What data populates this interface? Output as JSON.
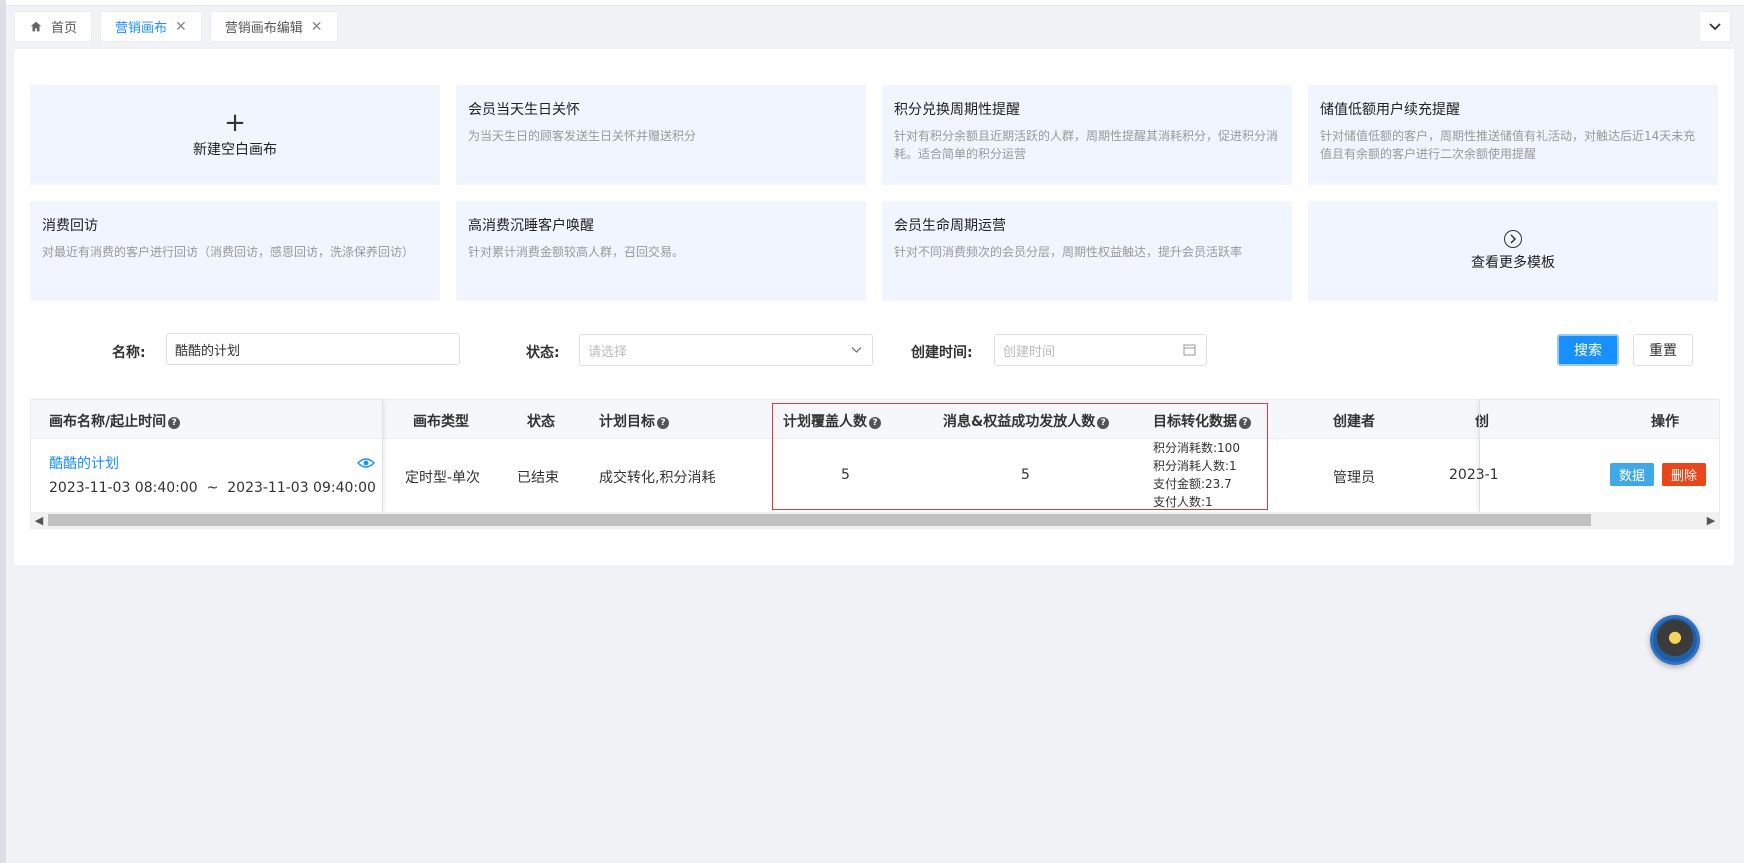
{
  "tabs": [
    {
      "label": "首页",
      "icon": "home-icon",
      "closable": false,
      "active": false
    },
    {
      "label": "营销画布",
      "closable": true,
      "active": true
    },
    {
      "label": "营销画布编辑",
      "closable": true,
      "active": false
    }
  ],
  "templates": [
    {
      "type": "new",
      "label": "新建空白画布",
      "icon": "plus-icon"
    },
    {
      "title": "会员当天生日关怀",
      "desc": "为当天生日的顾客发送生日关怀并赠送积分"
    },
    {
      "title": "积分兑换周期性提醒",
      "desc": "针对有积分余额且近期活跃的人群，周期性提醒其消耗积分，促进积分消耗。适合简单的积分运营"
    },
    {
      "title": "储值低额用户续充提醒",
      "desc": "针对储值低额的客户，周期性推送储值有礼活动，对触达后近14天未充值且有余额的客户进行二次余额使用提醒"
    },
    {
      "title": "消费回访",
      "desc": "对最近有消费的客户进行回访（消费回访，感恩回访，洗涤保养回访）"
    },
    {
      "title": "高消费沉睡客户唤醒",
      "desc": "针对累计消费金额较高人群，召回交易。"
    },
    {
      "title": "会员生命周期运营",
      "desc": "针对不同消费频次的会员分层，周期性权益触达，提升会员活跃率"
    },
    {
      "type": "more",
      "label": "查看更多模板",
      "icon": "circle-arrow-right-icon"
    }
  ],
  "filters": {
    "name_label": "名称:",
    "name_value": "酷酷的计划",
    "status_label": "状态:",
    "status_placeholder": "请选择",
    "created_label": "创建时间:",
    "created_placeholder": "创建时间",
    "search_label": "搜索",
    "reset_label": "重置"
  },
  "table": {
    "headers": {
      "name_time": "画布名称/起止时间",
      "type": "画布类型",
      "status": "状态",
      "goal": "计划目标",
      "coverage": "计划覆盖人数",
      "delivered": "消息&权益成功发放人数",
      "conversion": "目标转化数据",
      "creator": "创建者",
      "created_partial": "创",
      "actions": "操作"
    },
    "rows": [
      {
        "name": "酷酷的计划",
        "start": "2023-11-03 08:40:00",
        "sep": "~",
        "end": "2023-11-03 09:40:00",
        "type": "定时型-单次",
        "status": "已结束",
        "goal": "成交转化,积分消耗",
        "coverage": "5",
        "delivered": "5",
        "conversion": [
          "积分消耗数:100",
          "积分消耗人数:1",
          "支付金额:23.7",
          "支付人数:1"
        ],
        "creator": "管理员",
        "created_partial": "2023-1",
        "action_data": "数据",
        "action_delete": "删除"
      }
    ]
  },
  "colors": {
    "primary": "#1890ff",
    "data_button": "#3fa8e6",
    "delete_button": "#e8461b",
    "highlight_border": "#e53935"
  }
}
